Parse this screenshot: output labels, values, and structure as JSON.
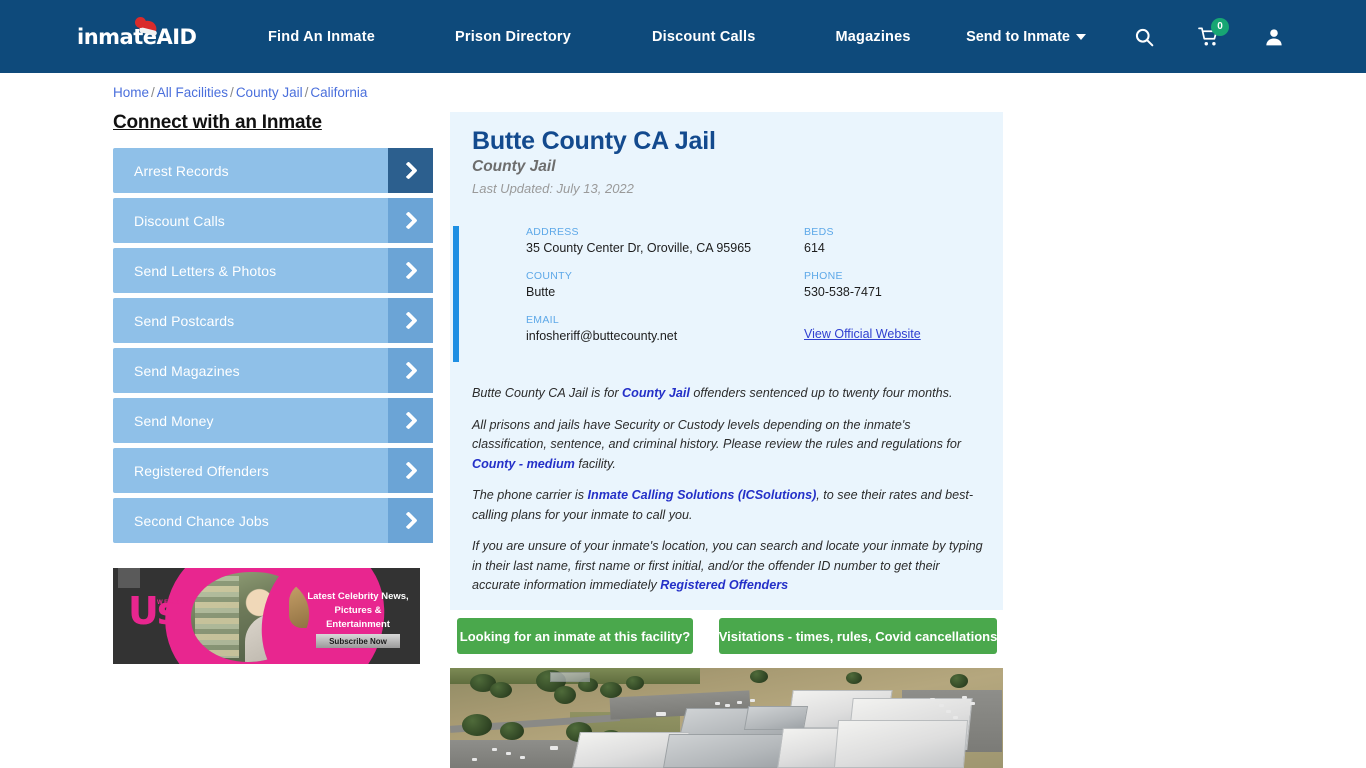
{
  "header": {
    "logo": {
      "part1": "inmate",
      "part2": "AID",
      "icon": "santa-hat-icon"
    },
    "nav": [
      {
        "label": "Find An Inmate"
      },
      {
        "label": "Prison Directory"
      },
      {
        "label": "Discount Calls"
      },
      {
        "label": "Magazines"
      }
    ],
    "send_to_inmate": "Send to Inmate",
    "icons": {
      "search": "search-icon",
      "cart": "shopping-cart-icon",
      "user": "user-account-icon"
    },
    "cart_count": "0",
    "colors": {
      "header_bg": "#0e4a7b",
      "cart_badge": "#17a673"
    }
  },
  "breadcrumb": {
    "items": [
      "Home",
      "All Facilities",
      "County Jail",
      "California"
    ],
    "separator": "/"
  },
  "sidebar": {
    "title": "Connect with an Inmate",
    "items": [
      {
        "label": "Arrest Records"
      },
      {
        "label": "Discount Calls"
      },
      {
        "label": "Send Letters & Photos"
      },
      {
        "label": "Send Postcards"
      },
      {
        "label": "Send Magazines"
      },
      {
        "label": "Send Money"
      },
      {
        "label": "Registered Offenders"
      },
      {
        "label": "Second Chance Jobs"
      }
    ],
    "ad": {
      "logo": "Us",
      "logo_sub": "WEEKLY",
      "copy": "Latest Celebrity News, Pictures & Entertainment",
      "cta": "Subscribe Now"
    }
  },
  "facility": {
    "title": "Butte County CA Jail",
    "subtitle": "County Jail",
    "last_updated": "Last Updated: July 13, 2022",
    "info": {
      "address_label": "ADDRESS",
      "address_value": "35 County Center Dr, Oroville, CA 95965",
      "beds_label": "BEDS",
      "beds_value": "614",
      "county_label": "COUNTY",
      "county_value": "Butte",
      "phone_label": "PHONE",
      "phone_value": "530-538-7471",
      "email_label": "EMAIL",
      "email_value": "infosheriff@buttecounty.net",
      "website_link": "View Official Website"
    },
    "paragraphs": {
      "p1_a": "Butte County CA Jail is for ",
      "p1_link": "County Jail",
      "p1_b": " offenders sentenced up to twenty four months.",
      "p2_a": "All prisons and jails have Security or Custody levels depending on the inmate's classification, sentence, and criminal history. Please review the rules and regulations for ",
      "p2_link": "County - medium",
      "p2_b": " facility.",
      "p3_a": "The phone carrier is ",
      "p3_link": "Inmate Calling Solutions (ICSolutions)",
      "p3_b": ", to see their rates and best-calling plans for your inmate to call you.",
      "p4_a": "If you are unsure of your inmate's location, you can search and locate your inmate by typing in their last name, first name or first initial, and/or the offender ID number to get their accurate information immediately ",
      "p4_link": "Registered Offenders"
    },
    "cta_buttons": [
      {
        "label": "Looking for an inmate at this facility?"
      },
      {
        "label": "Visitations - times, rules, Covid cancellations"
      }
    ],
    "photo": "aerial-facility-photo"
  }
}
